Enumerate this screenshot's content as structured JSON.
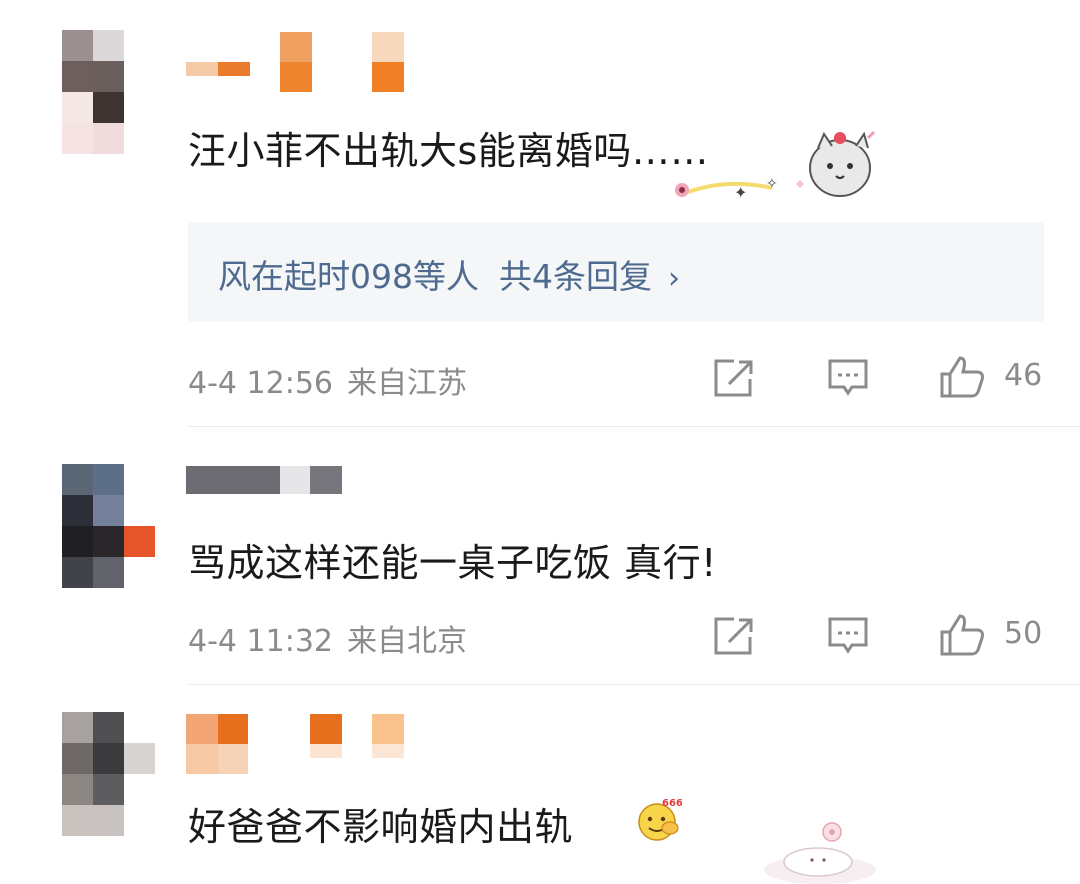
{
  "comments": [
    {
      "text": "汪小菲不出轨大s能离婚吗……",
      "reply_preview": {
        "users": "风在起时098等人",
        "count": "共4条回复"
      },
      "time": "4-4 12:56",
      "location": "来自江苏",
      "likes": "46"
    },
    {
      "text": "骂成这样还能一桌子吃饭 真行!",
      "time": "4-4 11:32",
      "location": "来自北京",
      "likes": "50"
    },
    {
      "text": "好爸爸不影响婚内出轨"
    }
  ],
  "icons": {
    "share": "share-icon",
    "comment": "comment-icon",
    "like": "thumbs-up-icon"
  },
  "colors": {
    "link_blue": "#4f6a8f",
    "meta_gray": "#8b8b8b",
    "reply_bg": "#f5f6f8"
  }
}
